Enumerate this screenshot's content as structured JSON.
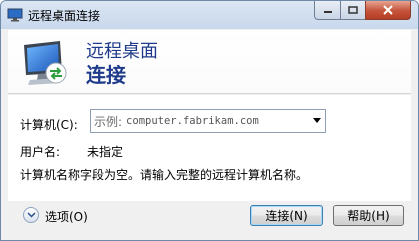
{
  "window": {
    "title": "远程桌面连接"
  },
  "banner": {
    "line1": "远程桌面",
    "line2": "连接"
  },
  "form": {
    "computer_label": "计算机(C):",
    "computer_prefix": "示例:",
    "computer_placeholder": "computer.fabrikam.com",
    "user_label": "用户名:",
    "user_value": "未指定",
    "message": "计算机名称字段为空。请输入完整的远程计算机名称。"
  },
  "footer": {
    "options_label": "选项(O)",
    "connect_label": "连接(N)",
    "help_label": "帮助(H)"
  },
  "colors": {
    "accent_blue": "#1e3a8a",
    "close_red": "#c4533a"
  },
  "icons": [
    "remote-desktop-icon",
    "minimize-icon",
    "maximize-icon",
    "close-icon",
    "chevron-down-icon",
    "dropdown-arrow-icon"
  ]
}
